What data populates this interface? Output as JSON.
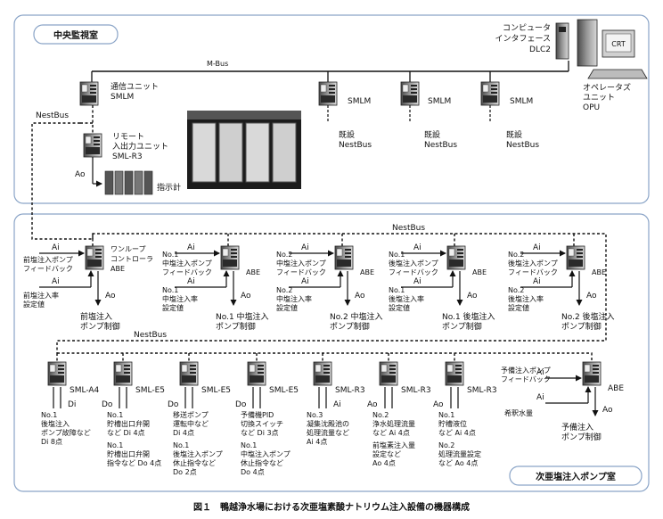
{
  "caption": "図１　鴨越浄水場における次亜塩素酸ナトリウム注入設備の機器構成",
  "rooms": {
    "central": "中央監視室",
    "pump": "次亜塩注入ポンプ室"
  },
  "bus": {
    "mbus": "M-Bus",
    "nestbus_top": "NestBus",
    "nestbus_mid": "NestBus",
    "nestbus_bottom": "NestBus"
  },
  "central": {
    "comm_unit": [
      "通信ユニット",
      "SMLM"
    ],
    "remote_io": [
      "リモート",
      "入出力ユニット",
      "SML-R3"
    ],
    "remote_ao": "Ao",
    "indicator": "指示計",
    "smlm_units": [
      {
        "label": "SMLM",
        "existing": [
          "既設",
          "NestBus"
        ]
      },
      {
        "label": "SMLM",
        "existing": [
          "既設",
          "NestBus"
        ]
      },
      {
        "label": "SMLM",
        "existing": [
          "既設",
          "NestBus"
        ]
      }
    ],
    "computer_if": [
      "コンピュータ",
      "インタフェース",
      "DLC2"
    ],
    "crt": "CRT",
    "opu": [
      "オペレータズ",
      "ユニット",
      "OPU"
    ]
  },
  "abe_units": [
    {
      "title": [
        "ワンループ",
        "コントローラ",
        "ABE"
      ],
      "label": "",
      "ai1": "Ai",
      "in1": [
        "前塩注入ポンプ",
        "フィードバック"
      ],
      "ai2": "Ai",
      "in2": [
        "前塩注入率",
        "設定値"
      ],
      "ao": "Ao",
      "out": [
        "前塩注入",
        "ポンプ制御"
      ]
    },
    {
      "title": [],
      "label": "ABE",
      "ai1": "Ai",
      "in1": [
        "No.1",
        "中塩注入ポンプ",
        "フィードバック"
      ],
      "ai2": "Ai",
      "in2": [
        "No.1",
        "中塩注入率",
        "設定値"
      ],
      "ao": "Ao",
      "out": [
        "No.1 中塩注入",
        "ポンプ制御"
      ]
    },
    {
      "title": [],
      "label": "ABE",
      "ai1": "Ai",
      "in1": [
        "No.2",
        "中塩注入ポンプ",
        "フィードバック"
      ],
      "ai2": "Ai",
      "in2": [
        "No.2",
        "中塩注入率",
        "設定値"
      ],
      "ao": "Ao",
      "out": [
        "No.2 中塩注入",
        "ポンプ制御"
      ]
    },
    {
      "title": [],
      "label": "ABE",
      "ai1": "Ai",
      "in1": [
        "No.1",
        "後塩注入ポンプ",
        "フィードバック"
      ],
      "ai2": "Ai",
      "in2": [
        "No.1",
        "後塩注入率",
        "設定値"
      ],
      "ao": "Ao",
      "out": [
        "No.1 後塩注入",
        "ポンプ制御"
      ]
    },
    {
      "title": [],
      "label": "ABE",
      "ai1": "Ai",
      "in1": [
        "No.2",
        "後塩注入ポンプ",
        "フィードバック"
      ],
      "ai2": "Ai",
      "in2": [
        "No.2",
        "後塩注入率",
        "設定値"
      ],
      "ao": "Ao",
      "out": [
        "No.2 後塩注入",
        "ポンプ制御"
      ]
    }
  ],
  "sml_units": [
    {
      "label": "SML-A4",
      "io": "Di",
      "notes": [
        [
          "No.1",
          "後塩注入",
          "ポンプ故障など",
          "Di 8点"
        ]
      ]
    },
    {
      "label": "SML-E5",
      "io": "Do",
      "notes": [
        [
          "No.1",
          "貯槽出口弁開",
          "など Di 4点"
        ],
        [
          "No.1",
          "貯槽出口弁開",
          "指令など Do 4点"
        ]
      ]
    },
    {
      "label": "SML-E5",
      "io": "Do",
      "notes": [
        [
          "移送ポンプ",
          "運転中など",
          "Di 4点"
        ],
        [
          "No.1",
          "後塩注入ポンプ",
          "休止指令など",
          "Do 2点"
        ]
      ]
    },
    {
      "label": "SML-E5",
      "io": "Do",
      "notes": [
        [
          "予備機PID",
          "切換スイッチ",
          "など Di 3点"
        ],
        [
          "No.1",
          "中塩注入ポンプ",
          "休止指令など",
          "Do 4点"
        ]
      ]
    },
    {
      "label": "SML-R3",
      "io": "Ai",
      "notes": [
        [
          "No.3",
          "凝集沈殿池の",
          "処理流量など",
          "Ai 4点"
        ]
      ]
    },
    {
      "label": "SML-R3",
      "io": "Ao",
      "notes": [
        [
          "No.2",
          "浄水処理流量",
          "など Ai 4点"
        ],
        [
          "前塩素注入量",
          "設定など",
          "Ao 4点"
        ]
      ]
    },
    {
      "label": "SML-R3",
      "io": "Ao",
      "notes": [
        [
          "No.1",
          "貯槽液位",
          "など Ai 4点"
        ],
        [
          "No.2",
          "処理流量設定",
          "など Ao 4点"
        ]
      ]
    }
  ],
  "spare_abe": {
    "label": "ABE",
    "ai1": "Ai",
    "in1": [
      "予備注入ポンプ",
      "フィードバック"
    ],
    "ai2": "Ai",
    "in2": "希釈水量",
    "ao": "Ao",
    "out": [
      "予備注入",
      "ポンプ制御"
    ]
  }
}
